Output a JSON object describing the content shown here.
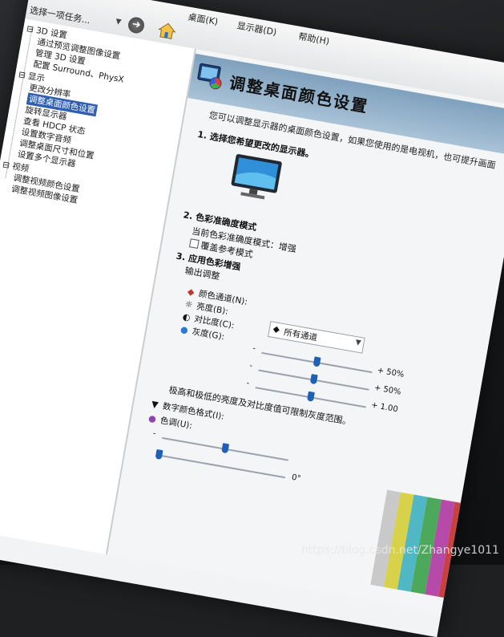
{
  "menubar": {
    "items": [
      "桌面(K)",
      "显示器(D)",
      "帮助(H)"
    ],
    "task_select": "选择一项任务...",
    "header_fragment": "调"
  },
  "tree": {
    "groups": [
      {
        "label": "3D 设置",
        "children": [
          "通过预览调整图像设置",
          "管理 3D 设置",
          "配置 Surround、PhysX"
        ]
      },
      {
        "label": "显示",
        "children": [
          "更改分辨率",
          "调整桌面颜色设置",
          "旋转显示器",
          "查看 HDCP 状态",
          "设置数字音频",
          "调整桌面尺寸和位置",
          "设置多个显示器"
        ]
      },
      {
        "label": "视频",
        "children": [
          "调整视频颜色设置",
          "调整视频图像设置"
        ]
      }
    ],
    "selected": "调整桌面颜色设置"
  },
  "content": {
    "title": "调整桌面颜色设置",
    "intro": "您可以调整显示器的桌面颜色设置，如果您使用的是电视机，也可提升画面",
    "section1": "1. 选择您希望更改的显示器。",
    "section2": "2. 色彩准确度模式",
    "current_mode": "当前色彩准确度模式：增强",
    "override_ref": "覆盖参考模式",
    "section3": "3. 应用色彩增强",
    "output_label": "输出调整",
    "channel_label": "颜色通道(N):",
    "channel_value": "所有通道",
    "brightness_label": "亮度(B):",
    "contrast_label": "对比度(C):",
    "gamma_label": "灰度(G):",
    "brightness_value": "+ 50%",
    "contrast_value": "+ 50%",
    "gamma_value": "+ 1.00",
    "minus": "-",
    "extreme_text": "极高和极低的亮度及对比度值可限制灰度范围。",
    "digital_vibrance_label": "数字颜色格式(I):",
    "hue_label": "色调(U):",
    "hue_value": "0°"
  },
  "levels": {
    "brightness": 0.5,
    "contrast": 0.5,
    "gamma": 0.5,
    "vibrance": 0.5,
    "hue": 0.0
  },
  "testcard_colors": [
    "#c9c9c9",
    "#d8d24a",
    "#4fb8c4",
    "#4ca85a",
    "#b64aa8",
    "#c84040",
    "#3a44b4"
  ],
  "watermark": "https://blog.csdn.net/Zhangye1011"
}
